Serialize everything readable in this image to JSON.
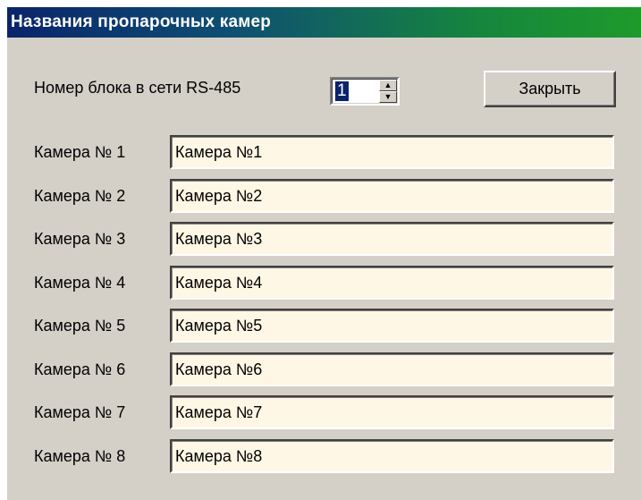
{
  "window": {
    "title": "Названия пропарочных камер"
  },
  "network": {
    "label": "Номер блока в сети RS-485",
    "block_number": "1"
  },
  "buttons": {
    "close_label": "Закрыть"
  },
  "cameras": [
    {
      "label": "Камера № 1",
      "value": "Камера №1"
    },
    {
      "label": "Камера № 2",
      "value": "Камера №2"
    },
    {
      "label": "Камера № 3",
      "value": "Камера №3"
    },
    {
      "label": "Камера № 4",
      "value": "Камера №4"
    },
    {
      "label": "Камера № 5",
      "value": "Камера №5"
    },
    {
      "label": "Камера № 6",
      "value": "Камера №6"
    },
    {
      "label": "Камера № 7",
      "value": "Камера №7"
    },
    {
      "label": "Камера № 8",
      "value": "Камера №8"
    }
  ],
  "colors": {
    "field_background": "#fff7e5",
    "dialog_background": "#d4d0c8",
    "title_gradient_start": "#0a246a",
    "title_gradient_end": "#1e9a2b"
  },
  "icons": {
    "spin_up": "triangle-up-icon",
    "spin_down": "triangle-down-icon"
  }
}
